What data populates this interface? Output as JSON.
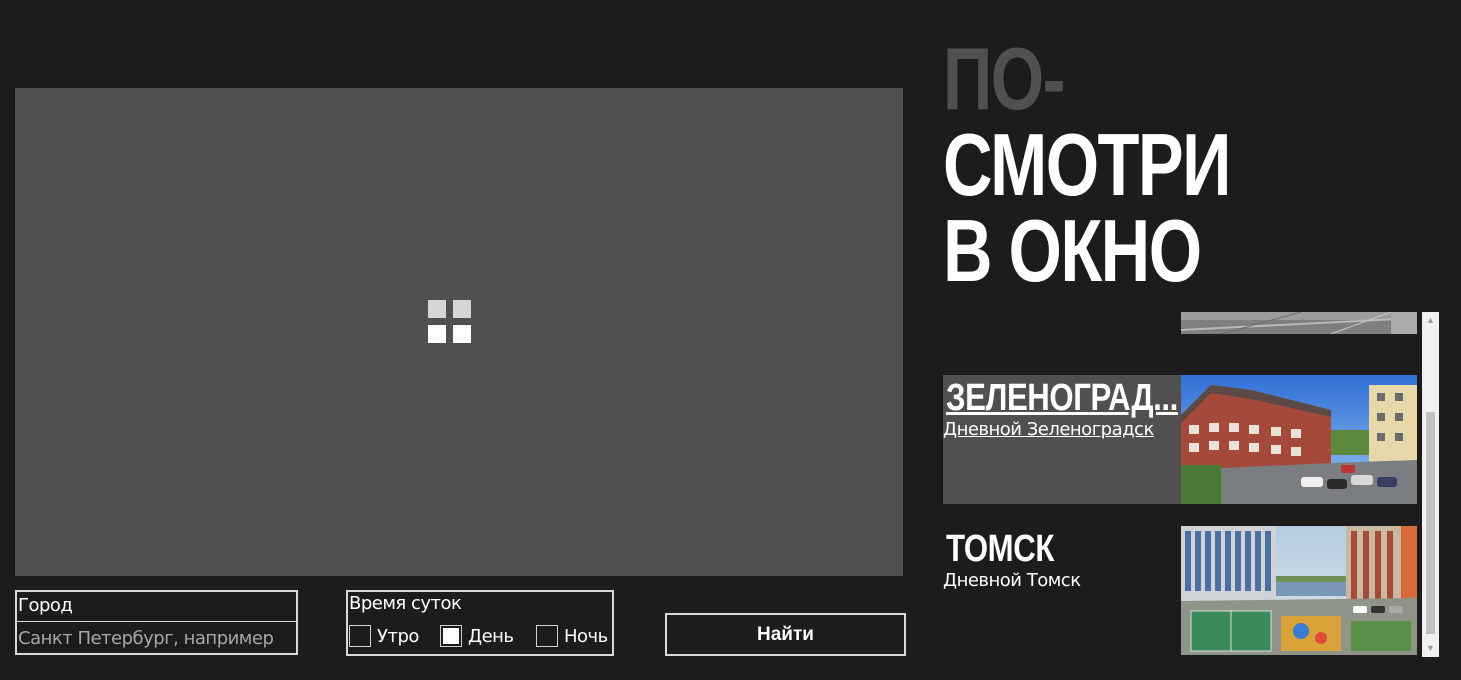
{
  "header": {
    "title_line1": "ПО-",
    "title_line2": "СМОТРИ",
    "title_line3": "В ОКНО"
  },
  "search": {
    "city_label": "Город",
    "city_value": "",
    "city_placeholder": "Санкт Петербург, например",
    "time_label": "Время суток",
    "options": [
      {
        "label": "Утро",
        "checked": false
      },
      {
        "label": "День",
        "checked": true
      },
      {
        "label": "Ночь",
        "checked": false
      }
    ],
    "find_label": "Найти"
  },
  "results": {
    "items": [
      {
        "name": "ЗЕЛЕНОГРАД...",
        "subtitle": "Дневной Зеленоградск",
        "active": true
      },
      {
        "name": "ТОМСК",
        "subtitle": "Дневной Томск",
        "active": false
      }
    ]
  },
  "colors": {
    "background": "#1d1b1c",
    "panel": "#524f4f",
    "text": "#ffffff"
  }
}
